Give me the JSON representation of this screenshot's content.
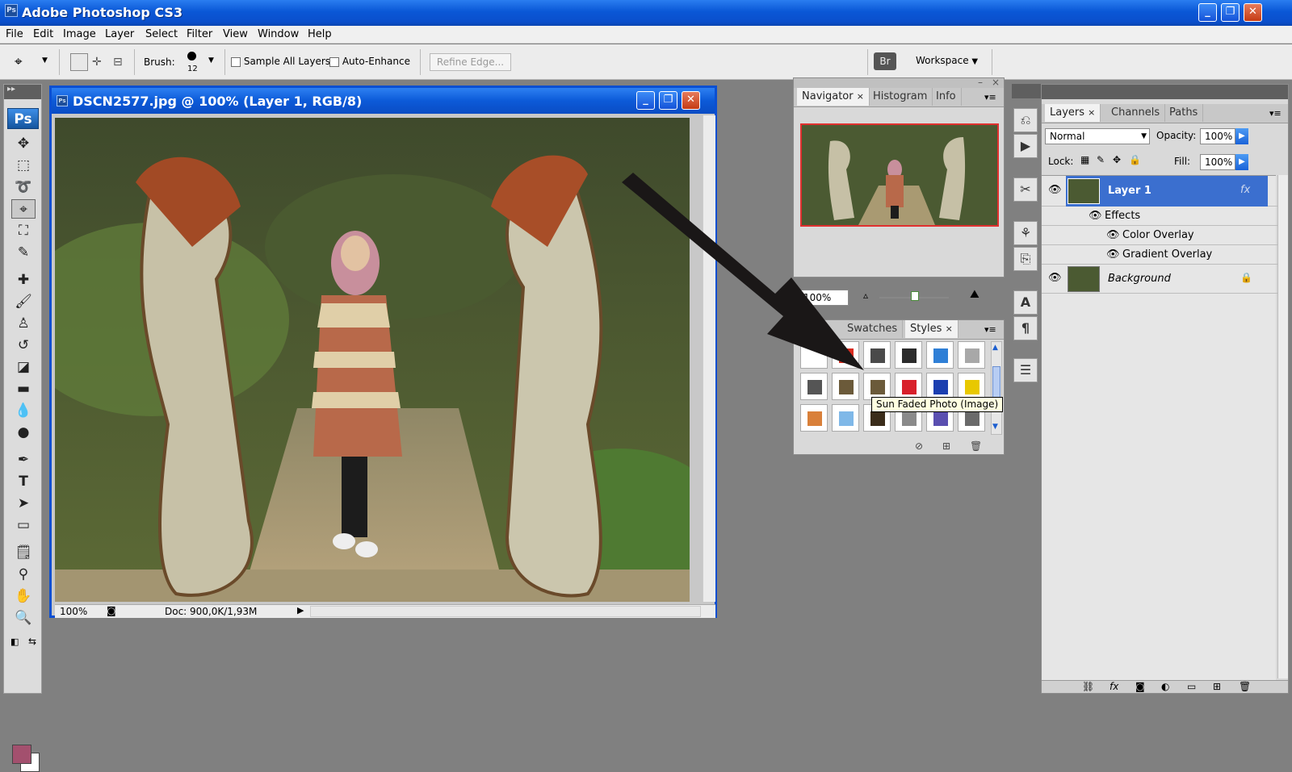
{
  "app": {
    "title": "Adobe Photoshop CS3",
    "icon_text": "Ps"
  },
  "window_controls": {
    "minimize": "_",
    "restore": "❐",
    "close": "✕"
  },
  "menu": [
    "File",
    "Edit",
    "Image",
    "Layer",
    "Select",
    "Filter",
    "View",
    "Window",
    "Help"
  ],
  "options": {
    "brush_label": "Brush:",
    "brush_size": "12",
    "sample_all_layers": "Sample All Layers",
    "auto_enhance": "Auto-Enhance",
    "refine_edge": "Refine Edge...",
    "workspace": "Workspace"
  },
  "toolbox": {
    "logo": "Ps",
    "grip": "▸▸"
  },
  "document": {
    "title": "DSCN2577.jpg @ 100% (Layer 1, RGB/8)",
    "zoom": "100%",
    "doc_info": "Doc: 900,0K/1,93M"
  },
  "navigator": {
    "tabs": [
      "Navigator",
      "Histogram",
      "Info"
    ],
    "zoom": "100%"
  },
  "styles": {
    "tabs": [
      "Swatches",
      "Styles"
    ],
    "tooltip": "Sun Faded Photo (Image)",
    "swatch_colors": [
      "#ffffff",
      "#d92b1e",
      "#4a4a4a",
      "#2b2b2b",
      "#2f7fd6",
      "#a8a8a8",
      "#555555",
      "#6b5a3a",
      "#6b5a3a",
      "#d8202a",
      "#1b3fb0",
      "#e8c800",
      "#d9803a",
      "#7fb8e8",
      "#3a2c1a",
      "#8a8a8a",
      "#5a4fb0",
      "#6a6a6a"
    ]
  },
  "layers": {
    "tabs": [
      "Layers",
      "Channels",
      "Paths"
    ],
    "blend_mode": "Normal",
    "opacity_label": "Opacity:",
    "opacity": "100%",
    "lock_label": "Lock:",
    "fill_label": "Fill:",
    "fill": "100%",
    "items": [
      {
        "name": "Layer 1",
        "selected": true,
        "fx": "fx"
      },
      {
        "name": "Effects"
      },
      {
        "name": "Color Overlay"
      },
      {
        "name": "Gradient Overlay"
      },
      {
        "name": "Background",
        "lock": "🔒"
      }
    ],
    "footer_icons": [
      "link-icon",
      "fx-icon",
      "mask-icon",
      "adjustment-icon",
      "folder-icon",
      "new-layer-icon",
      "trash-icon"
    ]
  }
}
